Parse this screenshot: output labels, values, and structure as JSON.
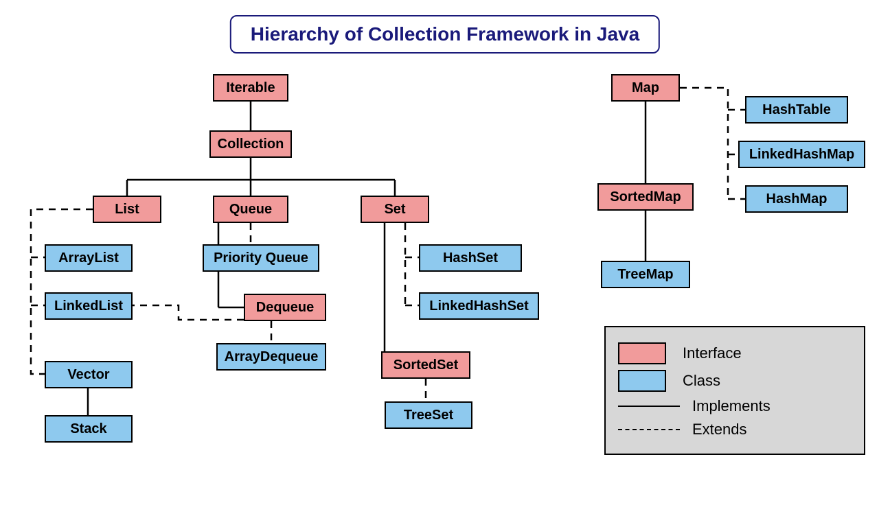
{
  "title": "Hierarchy of Collection Framework in Java",
  "nodes": {
    "iterable": {
      "label": "Iterable",
      "type": "iface"
    },
    "collection": {
      "label": "Collection",
      "type": "iface"
    },
    "list": {
      "label": "List",
      "type": "iface"
    },
    "queue": {
      "label": "Queue",
      "type": "iface"
    },
    "set": {
      "label": "Set",
      "type": "iface"
    },
    "arraylist": {
      "label": "ArrayList",
      "type": "cls"
    },
    "linkedlist": {
      "label": "LinkedList",
      "type": "cls"
    },
    "vector": {
      "label": "Vector",
      "type": "cls"
    },
    "stack": {
      "label": "Stack",
      "type": "cls"
    },
    "priorityqueue": {
      "label": "Priority Queue",
      "type": "cls"
    },
    "dequeue": {
      "label": "Dequeue",
      "type": "iface"
    },
    "arraydequeue": {
      "label": "ArrayDequeue",
      "type": "cls"
    },
    "hashset": {
      "label": "HashSet",
      "type": "cls"
    },
    "linkedhashset": {
      "label": "LinkedHashSet",
      "type": "cls"
    },
    "sortedset": {
      "label": "SortedSet",
      "type": "iface"
    },
    "treeset": {
      "label": "TreeSet",
      "type": "cls"
    },
    "map": {
      "label": "Map",
      "type": "iface"
    },
    "sortedmap": {
      "label": "SortedMap",
      "type": "iface"
    },
    "treemap": {
      "label": "TreeMap",
      "type": "cls"
    },
    "hashtable": {
      "label": "HashTable",
      "type": "cls"
    },
    "linkedhashmap": {
      "label": "LinkedHashMap",
      "type": "cls"
    },
    "hashmap": {
      "label": "HashMap",
      "type": "cls"
    }
  },
  "legend": {
    "iface_label": "Interface",
    "class_label": "Class",
    "solid_label": "Implements",
    "dash_label": "Extends"
  },
  "colors": {
    "iface_bg": "#f19b9b",
    "class_bg": "#8ec9ee",
    "title_color": "#1a1a7a"
  }
}
